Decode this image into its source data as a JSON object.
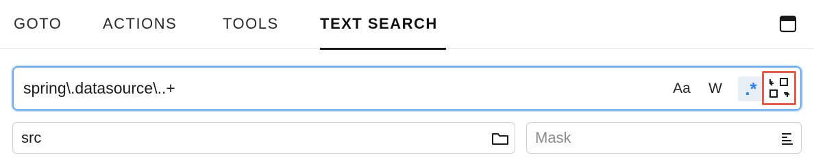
{
  "tabs": {
    "goto": "GOTO",
    "actions": "ACTIONS",
    "tools": "TOOLS",
    "text_search": "TEXT SEARCH",
    "active": "TEXT SEARCH"
  },
  "search": {
    "value": "spring\\.datasource\\..+",
    "match_case_label": "Aa",
    "whole_word_label": "W",
    "regex_label": ".*",
    "regex_enabled": true,
    "replace_toggle_icon": "replace-icon"
  },
  "path_field": {
    "value": "src",
    "icon": "folder-icon"
  },
  "mask_field": {
    "placeholder": "Mask",
    "value": "",
    "icon": "filter-lines-icon"
  },
  "colors": {
    "accent": "#2b7de9",
    "focus_border": "#6aa8ee",
    "highlight_box": "#e25c4d"
  }
}
